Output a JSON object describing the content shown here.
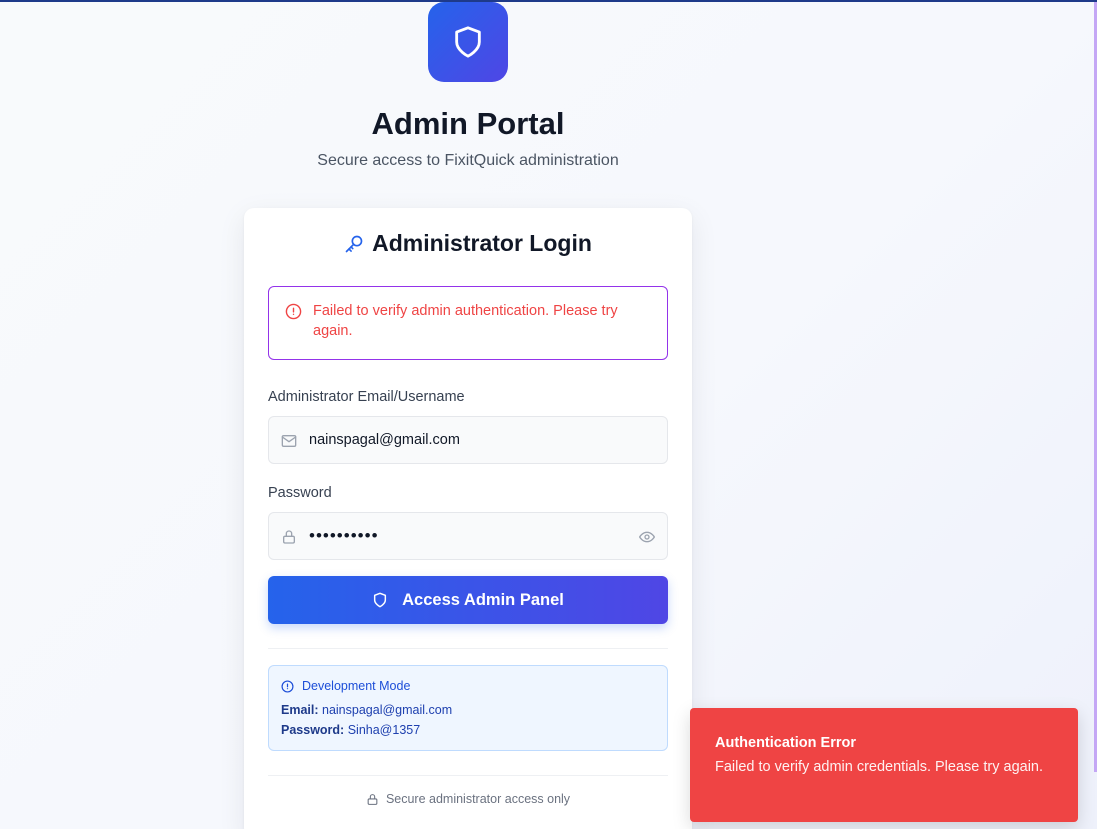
{
  "header": {
    "title": "Admin Portal",
    "subtitle": "Secure access to FixitQuick administration",
    "logo_icon": "shield-icon"
  },
  "login_card": {
    "title": "Administrator Login",
    "title_icon": "key-icon",
    "error": {
      "icon": "alert-circle-icon",
      "message": "Failed to verify admin authentication. Please try again."
    },
    "email_field": {
      "label": "Administrator Email/Username",
      "value": "nainspagal@gmail.com",
      "icon": "mail-icon"
    },
    "password_field": {
      "label": "Password",
      "value": "0123456789",
      "icon": "lock-icon",
      "toggle_icon": "eye-icon"
    },
    "submit_button": {
      "label": "Access Admin Panel",
      "icon": "shield-icon"
    },
    "dev_mode": {
      "title": "Development Mode",
      "icon": "info-icon",
      "email_label": "Email:",
      "email_value": "nainspagal@gmail.com",
      "password_label": "Password:",
      "password_value": "Sinha@1357"
    },
    "footer_note": "Secure administrator access only"
  },
  "toast": {
    "title": "Authentication Error",
    "message": "Failed to verify admin credentials. Please try again."
  },
  "colors": {
    "primary": "#2563eb",
    "primary_gradient_end": "#4f46e5",
    "error": "#ef4444",
    "error_border": "#9333ea",
    "info_bg": "#eff6ff"
  }
}
